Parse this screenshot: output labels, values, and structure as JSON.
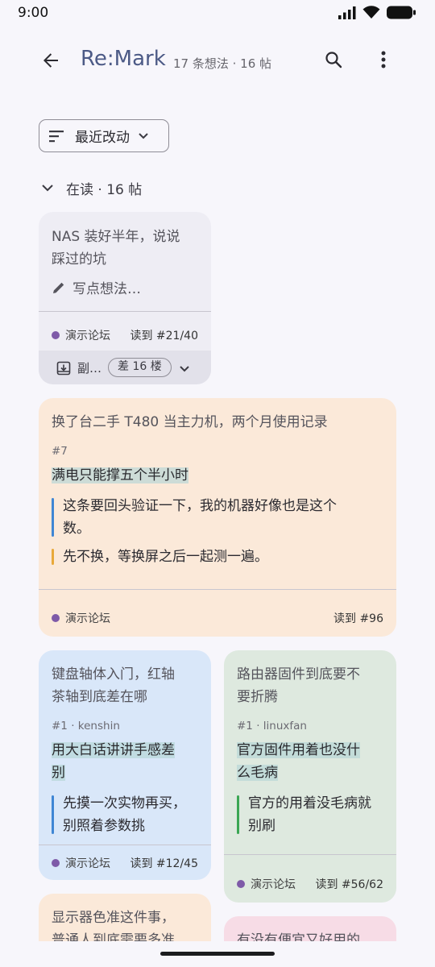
{
  "status": {
    "time": "9:00"
  },
  "app_bar": {
    "title": "Re:Mark",
    "subtitle": "17 条想法 · 16 帖"
  },
  "sort": {
    "label": "最近改动"
  },
  "section": {
    "label": "在读 · 16 帖"
  },
  "cards": [
    {
      "title_lines": [
        "NAS 装好半年，说说",
        "踩过的坑"
      ],
      "placeholder": "写点想法…",
      "forum": "演示论坛",
      "read": "读到 #21/40",
      "action_label": "副…",
      "gap_chip": "差 16 楼",
      "bg": "#eeedf4"
    },
    {
      "title_lines": [
        "换了台二手 T480 当主力机，两个月使用记录"
      ],
      "post_no": "#7",
      "highlight": "满电只能撑五个半小时",
      "quotes": [
        {
          "lines": [
            "这条要回头验证一下，我的机器好像也是这个",
            "数。"
          ],
          "color": "#3f86d4"
        },
        {
          "lines": [
            "先不换，等换屏之后一起测一遍。"
          ],
          "color": "#e8a93a"
        }
      ],
      "forum": "演示论坛",
      "read": "读到 #96",
      "bg": "#fbe9d9"
    },
    {
      "title_lines": [
        "键盘轴体入门，红轴",
        "茶轴到底差在哪"
      ],
      "post_no": "#1 · kenshin",
      "highlight_lines": [
        "用大白话讲讲手感差",
        "别"
      ],
      "quotes": [
        {
          "lines": [
            "先摸一次实物再买，",
            "别照着参数挑"
          ],
          "color": "#3f86d4"
        }
      ],
      "forum": "演示论坛",
      "read": "读到 #12/45",
      "bg": "#d9e7f9"
    },
    {
      "title_lines": [
        "路由器固件到底要不",
        "要折腾"
      ],
      "post_no": "#1 · linuxfan",
      "highlight_lines": [
        "官方固件用着也没什",
        "么毛病"
      ],
      "quotes": [
        {
          "lines": [
            "官方的用着没毛病就",
            "别刷"
          ],
          "color": "#3aa653"
        }
      ],
      "forum": "演示论坛",
      "read": "读到 #56/62",
      "bg": "#dee9df"
    },
    {
      "title_lines": [
        "显示器色准这件事，",
        "普通人到底需要多准"
      ],
      "bg": "#fbe9d9"
    },
    {
      "title_lines": [
        "有没有便宜又好用的"
      ],
      "bg": "#f7dce6"
    }
  ]
}
